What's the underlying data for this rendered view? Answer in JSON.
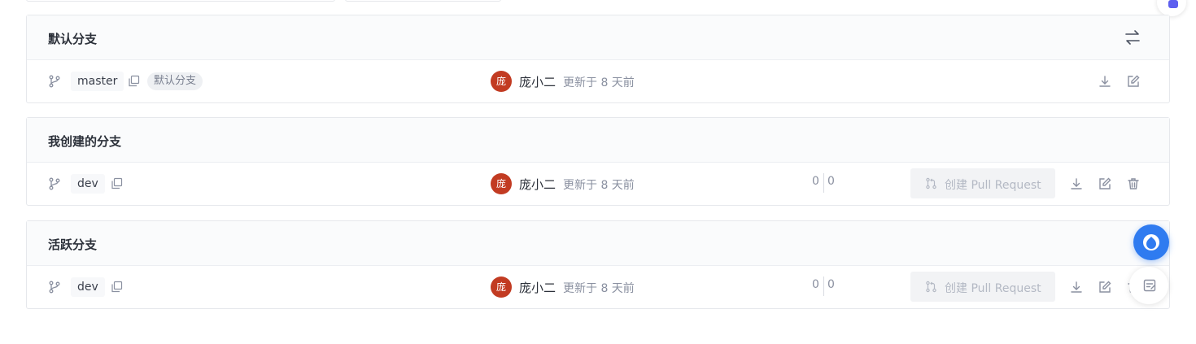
{
  "sections": {
    "default": {
      "title": "默认分支",
      "row": {
        "branch": "master",
        "badge": "默认分支",
        "avatar_char": "庞",
        "author": "庞小二",
        "updated": "更新于 8 天前"
      }
    },
    "mine": {
      "title": "我创建的分支",
      "row": {
        "branch": "dev",
        "avatar_char": "庞",
        "author": "庞小二",
        "updated": "更新于 8 天前",
        "ahead": "0",
        "behind": "0",
        "pr_label": "创建 Pull Request"
      }
    },
    "active": {
      "title": "活跃分支",
      "row": {
        "branch": "dev",
        "avatar_char": "庞",
        "author": "庞小二",
        "updated": "更新于 8 天前",
        "ahead": "0",
        "behind": "0",
        "pr_label": "创建 Pull Request"
      }
    }
  },
  "colors": {
    "avatar_bg": "#c23b22",
    "float_button": "#2f7bf0",
    "disabled_button_bg": "#f2f3f5"
  },
  "icons": {
    "branch": "git-branch-icon",
    "copy": "copy-icon",
    "download": "download-icon",
    "edit": "edit-icon",
    "delete": "trash-icon",
    "switch": "switch-arrows-icon",
    "pull_request": "pull-request-icon"
  }
}
